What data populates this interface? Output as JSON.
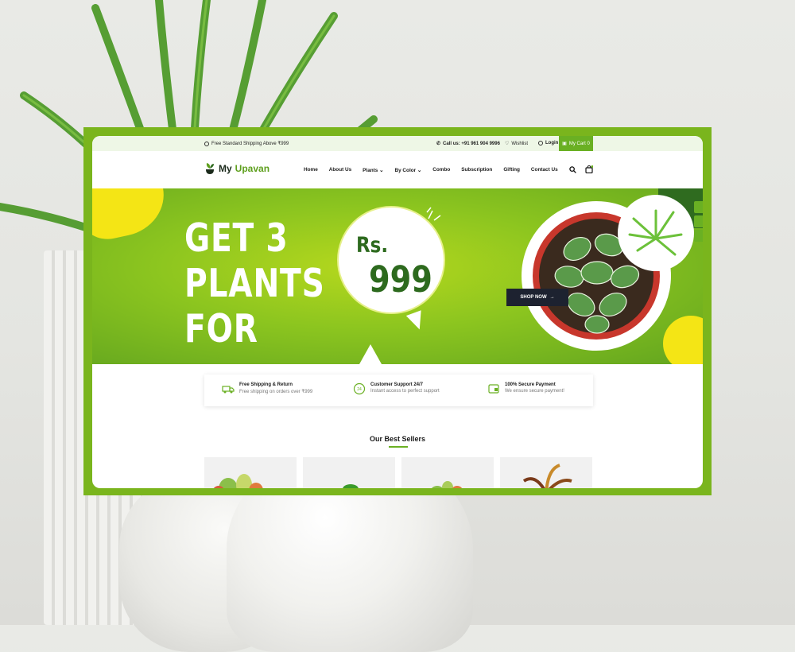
{
  "topbar": {
    "shipping": "Free Standard Shipping Above ₹999",
    "call": "Call us: +91 961 904 9996",
    "wishlist": "Wishlist",
    "login": "Login",
    "cart": "My Cart 0"
  },
  "logo": {
    "part1": "My",
    "part2": "Upavan"
  },
  "nav": {
    "items": [
      {
        "label": "Home"
      },
      {
        "label": "About Us"
      },
      {
        "label": "Plants ⌄"
      },
      {
        "label": "By Color ⌄"
      },
      {
        "label": "Combo"
      },
      {
        "label": "Subscription"
      },
      {
        "label": "Gifting"
      },
      {
        "label": "Contact Us"
      }
    ]
  },
  "hero": {
    "line1": "GET 3",
    "line2": "PLANTS",
    "line3": "FOR",
    "currency": "Rs.",
    "price": "999",
    "cta": "SHOP NOW"
  },
  "features": [
    {
      "title": "Free Shipping & Return",
      "subtitle": "Free shipping on orders over ₹999",
      "icon": "truck-icon"
    },
    {
      "title": "Customer Support 24/7",
      "subtitle": "Instant access to perfect support",
      "icon": "support-icon"
    },
    {
      "title": "100% Secure Payment",
      "subtitle": "We ensure secure payment!",
      "icon": "secure-payment-icon"
    }
  ],
  "best_sellers": {
    "title": "Our Best Sellers"
  },
  "colors": {
    "brand_green": "#6ab023",
    "frame_green": "#7ab51d",
    "hero_yellow": "#f4e515",
    "dark": "#1d2230"
  }
}
